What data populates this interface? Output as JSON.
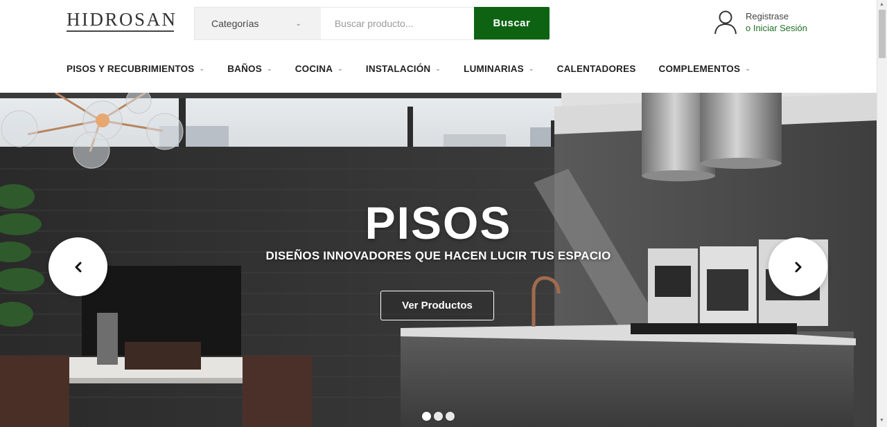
{
  "brand": {
    "logo_text": "HIDROSAN"
  },
  "search": {
    "category_label": "Categorías",
    "placeholder": "Buscar producto...",
    "button_label": "Buscar"
  },
  "account": {
    "register_label": "Registrase",
    "login_label": "o Iniciar Sesión"
  },
  "nav": {
    "items": [
      {
        "label": "PISOS Y RECUBRIMIENTOS",
        "has_dropdown": true
      },
      {
        "label": "BAÑOS",
        "has_dropdown": true
      },
      {
        "label": "COCINA",
        "has_dropdown": true
      },
      {
        "label": "INSTALACIÓN",
        "has_dropdown": true
      },
      {
        "label": "LUMINARIAS",
        "has_dropdown": true
      },
      {
        "label": "CALENTADORES",
        "has_dropdown": false
      },
      {
        "label": "COMPLEMENTOS",
        "has_dropdown": true
      }
    ]
  },
  "hero": {
    "title": "PISOS",
    "subtitle": "DISEÑOS INNOVADORES QUE HACEN LUCIR TUS ESPACIO",
    "cta_label": "Ver Productos",
    "slides_total": 3,
    "active_slide": 1
  },
  "colors": {
    "brand_green": "#0e6313",
    "link_green": "#1f6e25"
  },
  "icons": {
    "user": "user-icon",
    "prev": "chevron-left-icon",
    "next": "chevron-right-icon",
    "dropdown": "chevron-down-icon"
  }
}
